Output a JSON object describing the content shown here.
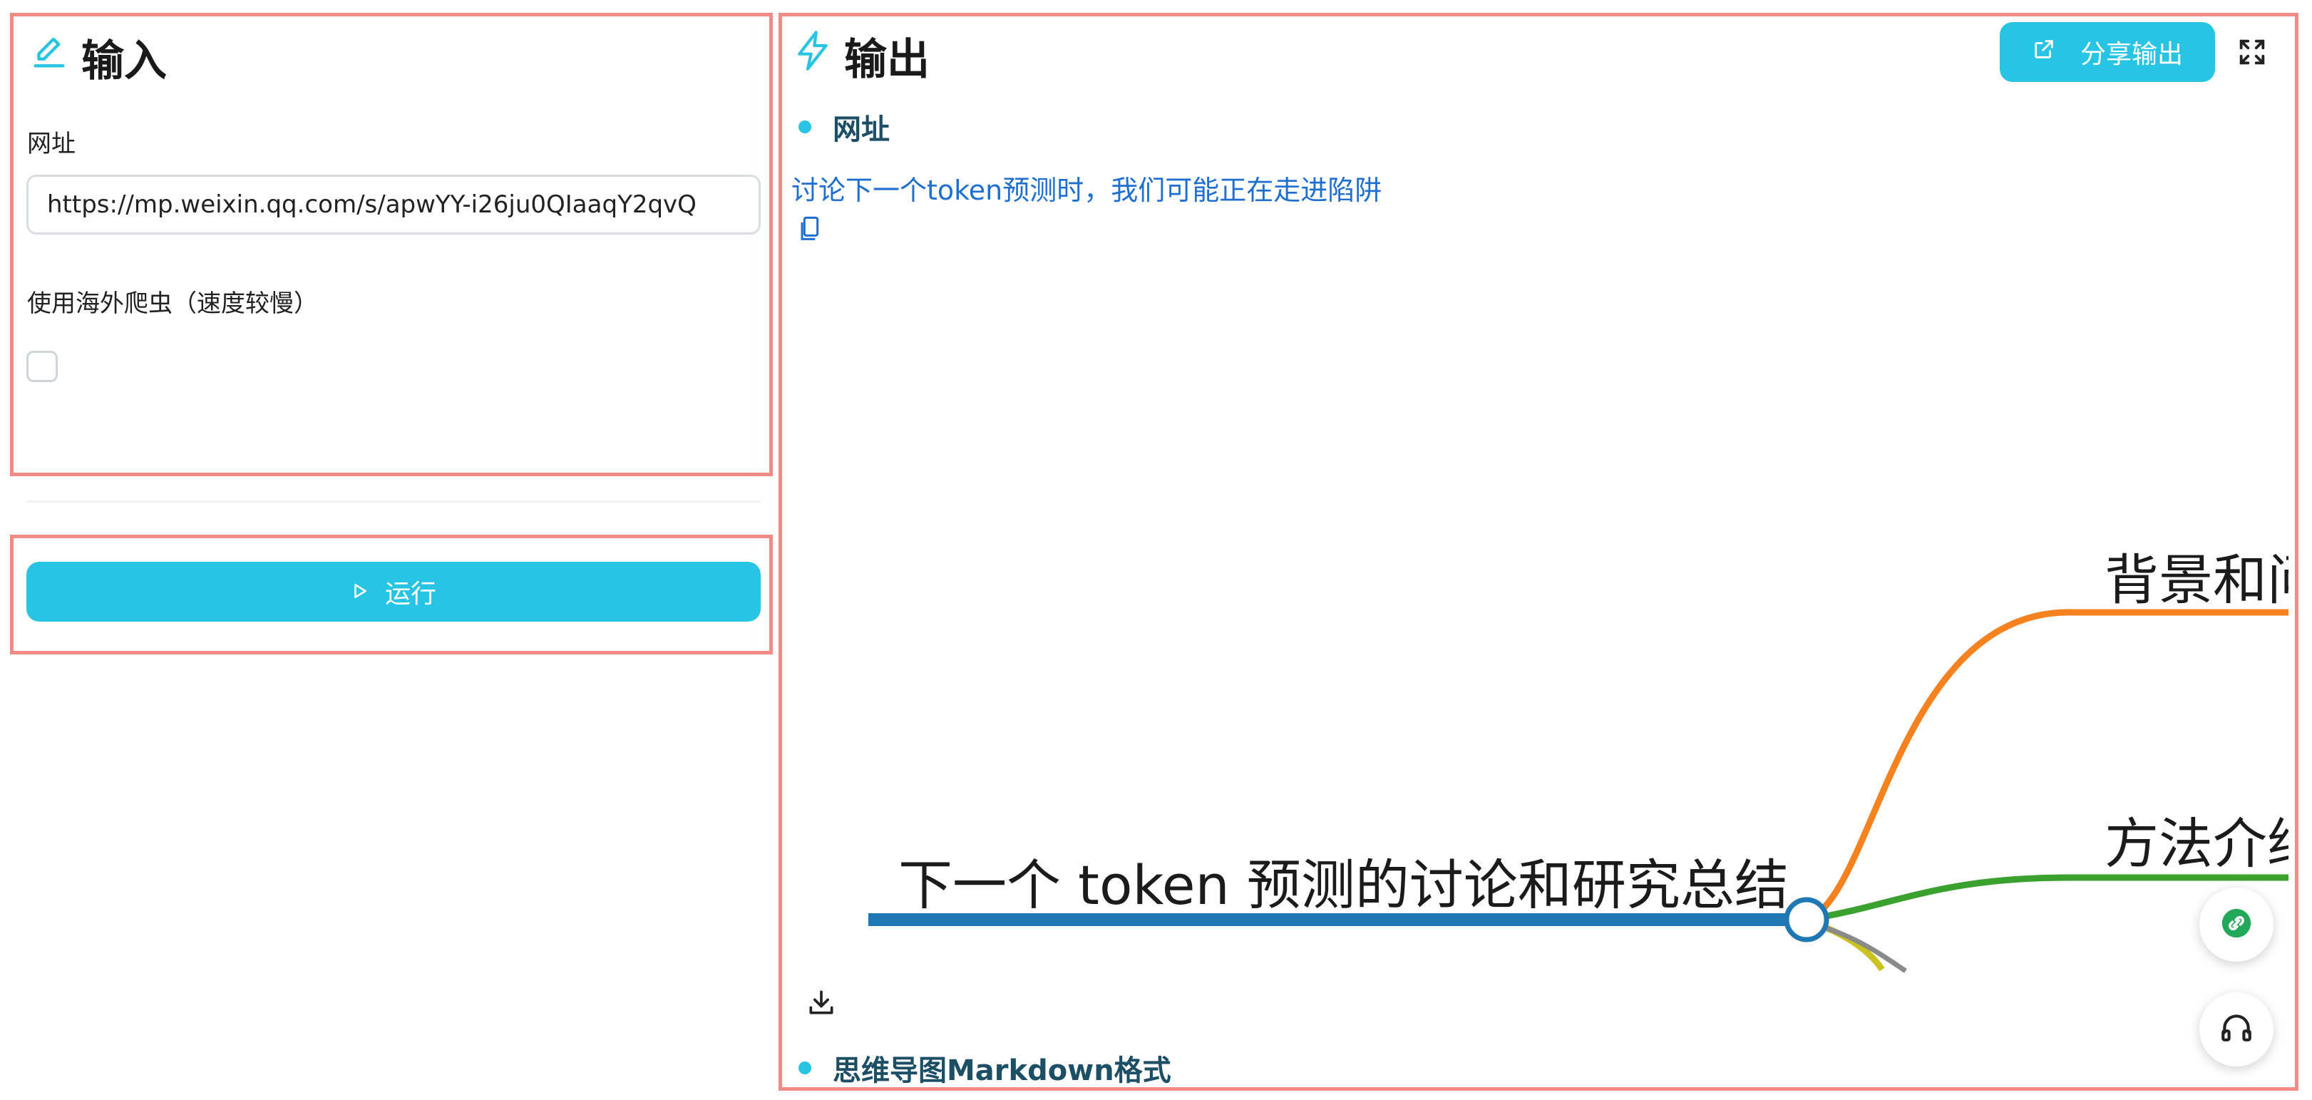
{
  "input_panel": {
    "title": "输入",
    "url_label": "网址",
    "url_value": "https://mp.weixin.qq.com/s/apwYY-i26ju0QIaaqY2qvQ",
    "overseas_crawler_label": "使用海外爬虫（速度较慢）",
    "overseas_crawler_checked": false
  },
  "run_button": {
    "label": "运行"
  },
  "output_panel": {
    "title": "输出",
    "share_label": "分享输出",
    "url_section_heading": "网址",
    "article_title": "讨论下一个token预测时，我们可能正在走进陷阱",
    "markdown_section_heading": "思维导图Markdown格式"
  },
  "mindmap": {
    "root": "下一个 token 预测的讨论和研究总结",
    "branches": [
      {
        "label": "背景和问",
        "color": "#f5821f"
      },
      {
        "label": "方法介绍",
        "color": "#3aa02e"
      },
      {
        "label": "",
        "color": "#c9c21f"
      },
      {
        "label": "",
        "color": "#8a8a8a"
      }
    ],
    "root_color": "#1f77b4"
  },
  "icons": {
    "input": "edit-icon",
    "output": "lightning-icon",
    "run": "play-icon",
    "share": "external-link-icon",
    "fullscreen": "fullscreen-icon",
    "copy": "copy-icon",
    "download": "download-icon",
    "float_link": "link-icon",
    "float_support": "headset-icon"
  },
  "colors": {
    "accent": "#28c4e4",
    "frame": "#f08b86",
    "heading": "#1c4f66",
    "link": "#1e6fd1"
  }
}
